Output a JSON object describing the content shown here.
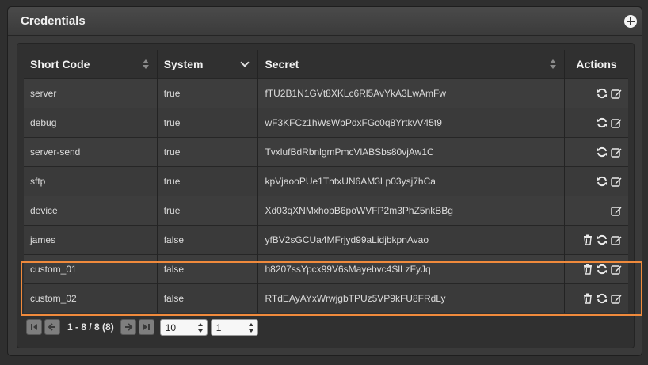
{
  "panel": {
    "title": "Credentials",
    "add_icon": "plus-circle-icon"
  },
  "table": {
    "columns": [
      "Short Code",
      "System",
      "Secret",
      "Actions"
    ],
    "rows": [
      {
        "short_code": "server",
        "system": "true",
        "secret": "fTU2B1N1GVt8XKLc6Rl5AvYkA3LwAmFw",
        "actions": [
          "refresh",
          "edit"
        ]
      },
      {
        "short_code": "debug",
        "system": "true",
        "secret": "wF3KFCz1hWsWbPdxFGc0q8YrtkvV45t9",
        "actions": [
          "refresh",
          "edit"
        ]
      },
      {
        "short_code": "server-send",
        "system": "true",
        "secret": "TvxlufBdRbnlgmPmcVlABSbs80vjAw1C",
        "actions": [
          "refresh",
          "edit"
        ]
      },
      {
        "short_code": "sftp",
        "system": "true",
        "secret": "kpVjaooPUe1ThtxUN6AM3Lp03ysj7hCa",
        "actions": [
          "refresh",
          "edit"
        ]
      },
      {
        "short_code": "device",
        "system": "true",
        "secret": "Xd03qXNMxhobB6poWVFP2m3PhZ5nkBBg",
        "actions": [
          "edit"
        ]
      },
      {
        "short_code": "james",
        "system": "false",
        "secret": "yfBV2sGCUa4MFrjyd99aLidjbkpnAvao",
        "actions": [
          "delete",
          "refresh",
          "edit"
        ]
      },
      {
        "short_code": "custom_01",
        "system": "false",
        "secret": "h8207ssYpcx99V6sMayebvc4SlLzFyJq",
        "actions": [
          "delete",
          "refresh",
          "edit"
        ]
      },
      {
        "short_code": "custom_02",
        "system": "false",
        "secret": "RTdEAyAYxWrwjgbTPUz5VP9kFU8FRdLy",
        "actions": [
          "delete",
          "refresh",
          "edit"
        ]
      }
    ]
  },
  "pager": {
    "info": "1 - 8 / 8 (8)",
    "page_size": "10",
    "page": "1"
  },
  "colors": {
    "highlight": "#f08a3c",
    "background": "#2f2f2f"
  }
}
